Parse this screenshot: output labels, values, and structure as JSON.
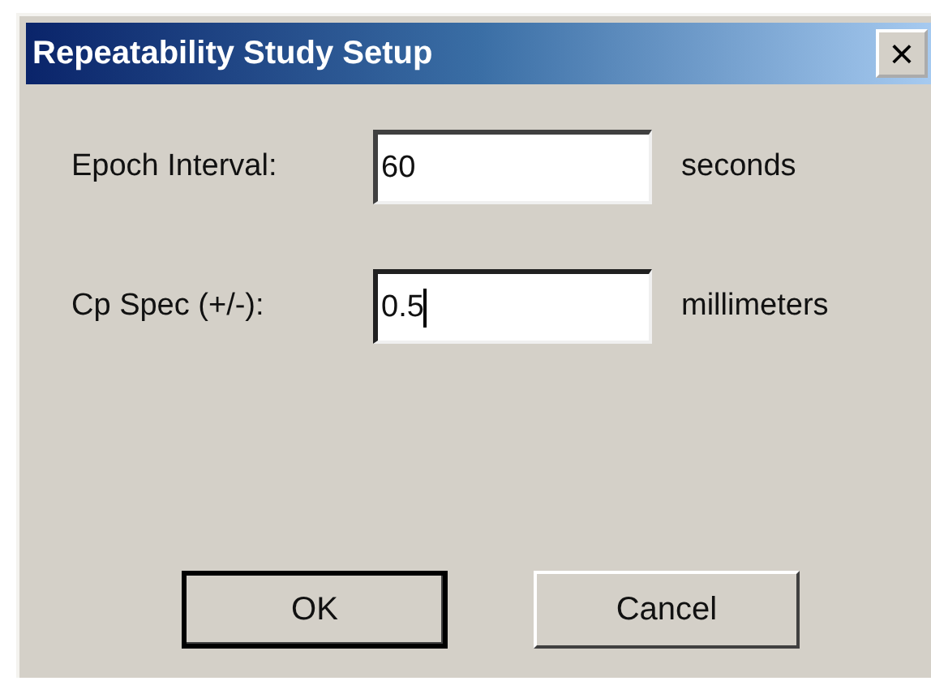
{
  "window": {
    "title": "Repeatability Study Setup",
    "close_button": "×"
  },
  "fields": [
    {
      "label": "Epoch Interval:",
      "value": "60",
      "unit": "seconds",
      "focused": false
    },
    {
      "label": "Cp Spec (+/-):",
      "value": "0.5",
      "unit": "millimeters",
      "focused": true
    }
  ],
  "buttons": [
    {
      "label": "OK",
      "default": true
    },
    {
      "label": "Cancel",
      "default": false
    }
  ]
}
